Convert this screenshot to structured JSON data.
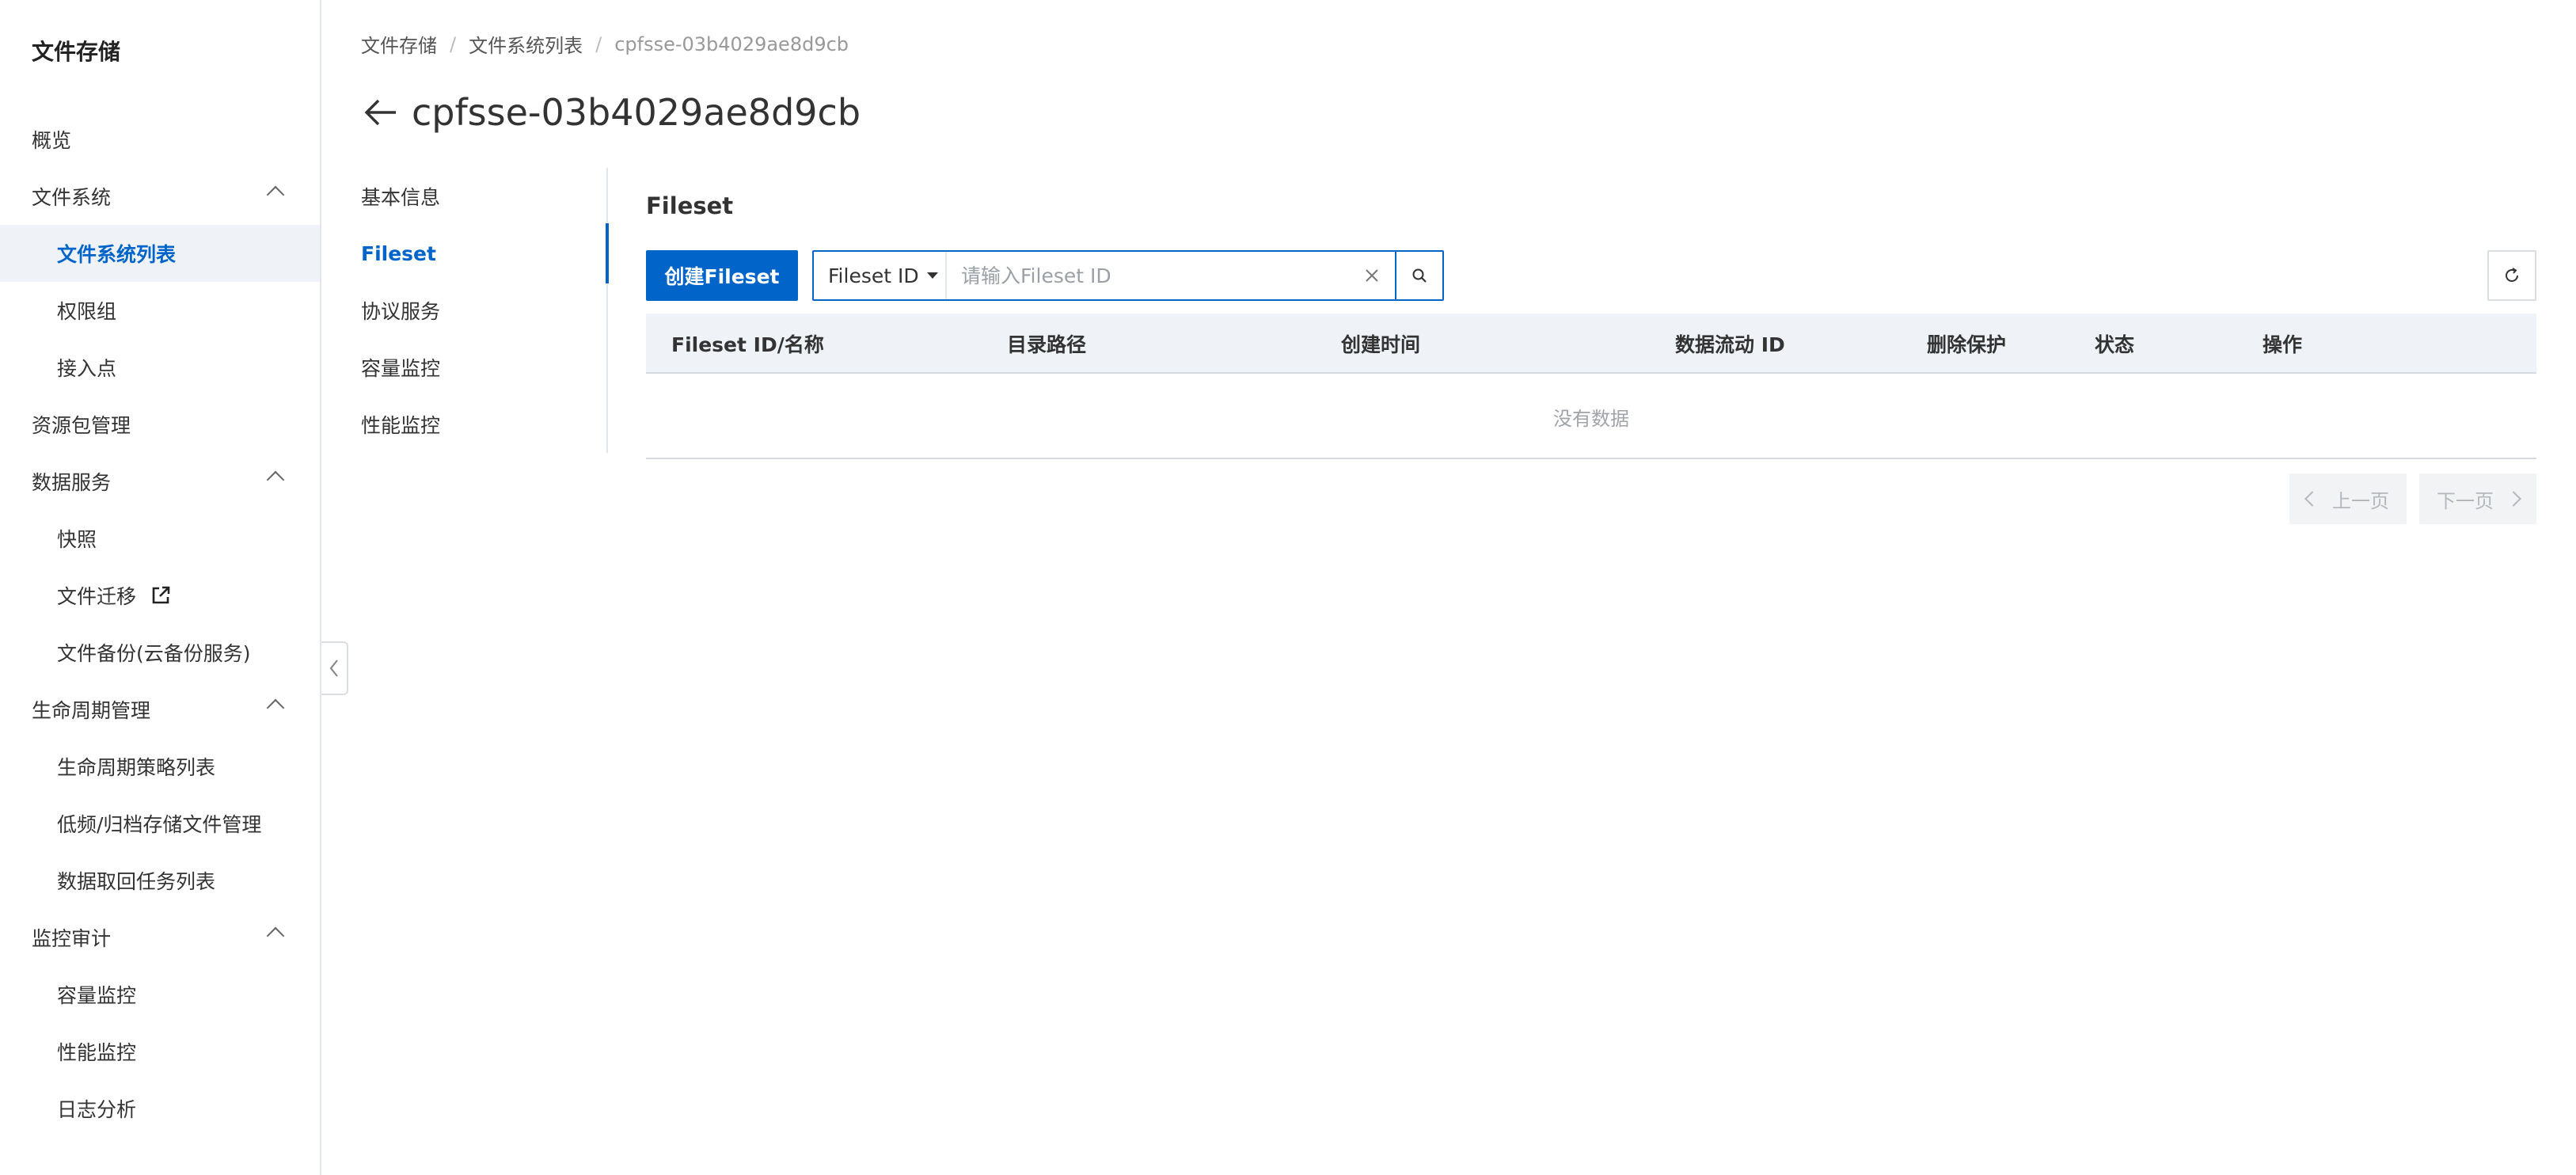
{
  "sidebar": {
    "title": "文件存储",
    "items": [
      {
        "label": "概览"
      },
      {
        "label": "文件系统"
      },
      {
        "label": "文件系统列表"
      },
      {
        "label": "权限组"
      },
      {
        "label": "接入点"
      },
      {
        "label": "资源包管理"
      },
      {
        "label": "数据服务"
      },
      {
        "label": "快照"
      },
      {
        "label": "文件迁移"
      },
      {
        "label": "文件备份(云备份服务)"
      },
      {
        "label": "生命周期管理"
      },
      {
        "label": "生命周期策略列表"
      },
      {
        "label": "低频/归档存储文件管理"
      },
      {
        "label": "数据取回任务列表"
      },
      {
        "label": "监控审计"
      },
      {
        "label": "容量监控"
      },
      {
        "label": "性能监控"
      },
      {
        "label": "日志分析"
      }
    ]
  },
  "breadcrumb": {
    "items": [
      "文件存储",
      "文件系统列表",
      "cpfsse-03b4029ae8d9cb"
    ],
    "separator": "/"
  },
  "header": {
    "title": "cpfsse-03b4029ae8d9cb"
  },
  "subnav": {
    "items": [
      {
        "label": "基本信息"
      },
      {
        "label": "Fileset"
      },
      {
        "label": "协议服务"
      },
      {
        "label": "容量监控"
      },
      {
        "label": "性能监控"
      }
    ]
  },
  "main": {
    "section_title": "Fileset",
    "create_button": "创建Fileset",
    "search": {
      "select_value": "Fileset ID",
      "placeholder": "请输入Fileset ID",
      "value": ""
    },
    "table": {
      "columns": [
        "Fileset ID/名称",
        "目录路径",
        "创建时间",
        "数据流动 ID",
        "删除保护",
        "状态",
        "操作"
      ],
      "rows": [],
      "empty_text": "没有数据"
    },
    "pagination": {
      "prev": "上一页",
      "next": "下一页"
    }
  },
  "colors": {
    "accent": "#0064c8",
    "sidebar_active_bg": "#eff3f8",
    "table_header_bg": "#eff3f8"
  }
}
